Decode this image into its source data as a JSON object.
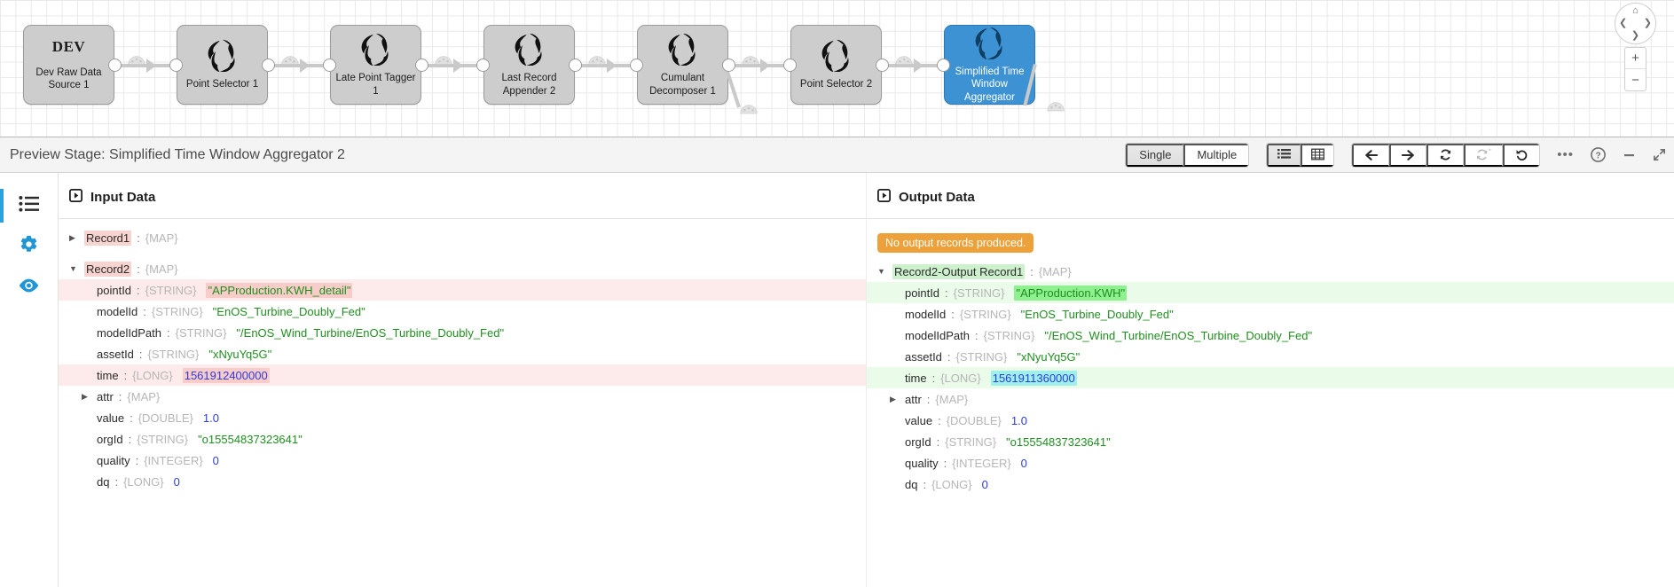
{
  "pipeline": {
    "nodes": [
      {
        "id": "dev-raw-data-source-1",
        "dev_label": "DEV",
        "label": "Dev Raw Data\nSource 1",
        "icon": "none",
        "selected": false
      },
      {
        "id": "point-selector-1",
        "dev_label": "",
        "label": "Point Selector 1",
        "icon": "swirl-icon",
        "selected": false
      },
      {
        "id": "late-point-tagger-1",
        "dev_label": "",
        "label": "Late Point Tagger 1",
        "icon": "swirl-icon",
        "selected": false
      },
      {
        "id": "last-record-appender-2",
        "dev_label": "",
        "label": "Last Record\nAppender 2",
        "icon": "swirl-icon",
        "selected": false
      },
      {
        "id": "cumulant-decomposer-1",
        "dev_label": "",
        "label": "Cumulant\nDecomposer 1",
        "icon": "swirl-icon",
        "selected": false
      },
      {
        "id": "point-selector-2",
        "dev_label": "",
        "label": "Point Selector 2",
        "icon": "swirl-icon",
        "selected": false
      },
      {
        "id": "simplified-time-window-aggregator",
        "dev_label": "",
        "label": "Simplified Time\nWindow Aggregator",
        "icon": "swirl-icon",
        "selected": true
      }
    ],
    "zoom_in_label": "+",
    "zoom_out_label": "−"
  },
  "toolbar": {
    "title": "Preview Stage: Simplified Time Window Aggregator 2",
    "record_mode": {
      "options": [
        "Single",
        "Multiple"
      ],
      "selected": "Single"
    },
    "view_mode": {
      "options": [
        "list-view-icon",
        "table-view-icon"
      ],
      "selected": "list-view-icon"
    },
    "nav": [
      {
        "name": "step-back-button",
        "icon": "arrow-left-icon",
        "disabled": false
      },
      {
        "name": "step-forward-button",
        "icon": "arrow-right-icon",
        "disabled": false
      },
      {
        "name": "refresh-button",
        "icon": "refresh-icon",
        "disabled": false
      },
      {
        "name": "refresh-all-button",
        "icon": "refresh-asterisk-icon",
        "disabled": true
      },
      {
        "name": "revert-button",
        "icon": "undo-icon",
        "disabled": false
      }
    ],
    "more_label": "•••",
    "help_label": "?",
    "minimize_label": "—"
  },
  "rail": {
    "items": [
      {
        "name": "sidebar-item-list",
        "icon": "list-icon",
        "active": true
      },
      {
        "name": "sidebar-item-settings",
        "icon": "gear-icon",
        "active": false
      },
      {
        "name": "sidebar-item-preview",
        "icon": "eye-icon",
        "active": false
      }
    ]
  },
  "input_pane": {
    "title": "Input Data",
    "records": [
      {
        "name": "Record1",
        "expanded": false,
        "caret": "▶",
        "type": "{MAP}",
        "key_highlight": "pink",
        "fields": []
      },
      {
        "name": "Record2",
        "expanded": true,
        "caret": "▼",
        "type": "{MAP}",
        "key_highlight": "pink",
        "fields": [
          {
            "key": "pointId",
            "type": "{STRING}",
            "value": "\"APProduction.KWH_detail\"",
            "value_kind": "str",
            "row_highlight": "pink",
            "value_highlight": "pink"
          },
          {
            "key": "modelId",
            "type": "{STRING}",
            "value": "\"EnOS_Turbine_Doubly_Fed\"",
            "value_kind": "str",
            "row_highlight": "none",
            "value_highlight": "none"
          },
          {
            "key": "modelIdPath",
            "type": "{STRING}",
            "value": "\"/EnOS_Wind_Turbine/EnOS_Turbine_Doubly_Fed\"",
            "value_kind": "str",
            "row_highlight": "none",
            "value_highlight": "none"
          },
          {
            "key": "assetId",
            "type": "{STRING}",
            "value": "\"xNyuYq5G\"",
            "value_kind": "str",
            "row_highlight": "none",
            "value_highlight": "none"
          },
          {
            "key": "time",
            "type": "{LONG}",
            "value": "1561912400000",
            "value_kind": "num",
            "row_highlight": "pink",
            "value_highlight": "pink"
          },
          {
            "key": "attr",
            "type": "{MAP}",
            "value": "",
            "value_kind": "none",
            "row_highlight": "none",
            "value_highlight": "none",
            "caret": "▶"
          },
          {
            "key": "value",
            "type": "{DOUBLE}",
            "value": "1.0",
            "value_kind": "num",
            "row_highlight": "none",
            "value_highlight": "none"
          },
          {
            "key": "orgId",
            "type": "{STRING}",
            "value": "\"o15554837323641\"",
            "value_kind": "str",
            "row_highlight": "none",
            "value_highlight": "none"
          },
          {
            "key": "quality",
            "type": "{INTEGER}",
            "value": "0",
            "value_kind": "num",
            "row_highlight": "none",
            "value_highlight": "none"
          },
          {
            "key": "dq",
            "type": "{LONG}",
            "value": "0",
            "value_kind": "num",
            "row_highlight": "none",
            "value_highlight": "none"
          }
        ]
      }
    ]
  },
  "output_pane": {
    "title": "Output Data",
    "notice": "No output records produced.",
    "records": [
      {
        "name": "Record2-Output Record1",
        "expanded": true,
        "caret": "▼",
        "type": "{MAP}",
        "key_highlight": "green",
        "fields": [
          {
            "key": "pointId",
            "type": "{STRING}",
            "value": "\"APProduction.KWH\"",
            "value_kind": "str",
            "row_highlight": "green",
            "value_highlight": "green"
          },
          {
            "key": "modelId",
            "type": "{STRING}",
            "value": "\"EnOS_Turbine_Doubly_Fed\"",
            "value_kind": "str",
            "row_highlight": "none",
            "value_highlight": "none"
          },
          {
            "key": "modelIdPath",
            "type": "{STRING}",
            "value": "\"/EnOS_Wind_Turbine/EnOS_Turbine_Doubly_Fed\"",
            "value_kind": "str",
            "row_highlight": "none",
            "value_highlight": "none"
          },
          {
            "key": "assetId",
            "type": "{STRING}",
            "value": "\"xNyuYq5G\"",
            "value_kind": "str",
            "row_highlight": "none",
            "value_highlight": "none"
          },
          {
            "key": "time",
            "type": "{LONG}",
            "value": "1561911360000",
            "value_kind": "num",
            "row_highlight": "green",
            "value_highlight": "cyan"
          },
          {
            "key": "attr",
            "type": "{MAP}",
            "value": "",
            "value_kind": "none",
            "row_highlight": "none",
            "value_highlight": "none",
            "caret": "▶"
          },
          {
            "key": "value",
            "type": "{DOUBLE}",
            "value": "1.0",
            "value_kind": "num",
            "row_highlight": "none",
            "value_highlight": "none"
          },
          {
            "key": "orgId",
            "type": "{STRING}",
            "value": "\"o15554837323641\"",
            "value_kind": "str",
            "row_highlight": "none",
            "value_highlight": "none"
          },
          {
            "key": "quality",
            "type": "{INTEGER}",
            "value": "0",
            "value_kind": "num",
            "row_highlight": "none",
            "value_highlight": "none"
          },
          {
            "key": "dq",
            "type": "{LONG}",
            "value": "0",
            "value_kind": "num",
            "row_highlight": "none",
            "value_highlight": "none"
          }
        ]
      }
    ]
  },
  "colors": {
    "selected_node": "#3d92d4",
    "accent": "#29a3e0",
    "badge": "#eda13b",
    "string_value": "#1f8f1f",
    "number_value": "#2d3ce0",
    "highlight_pink": "#fdeaea",
    "highlight_green": "#eafbea"
  }
}
